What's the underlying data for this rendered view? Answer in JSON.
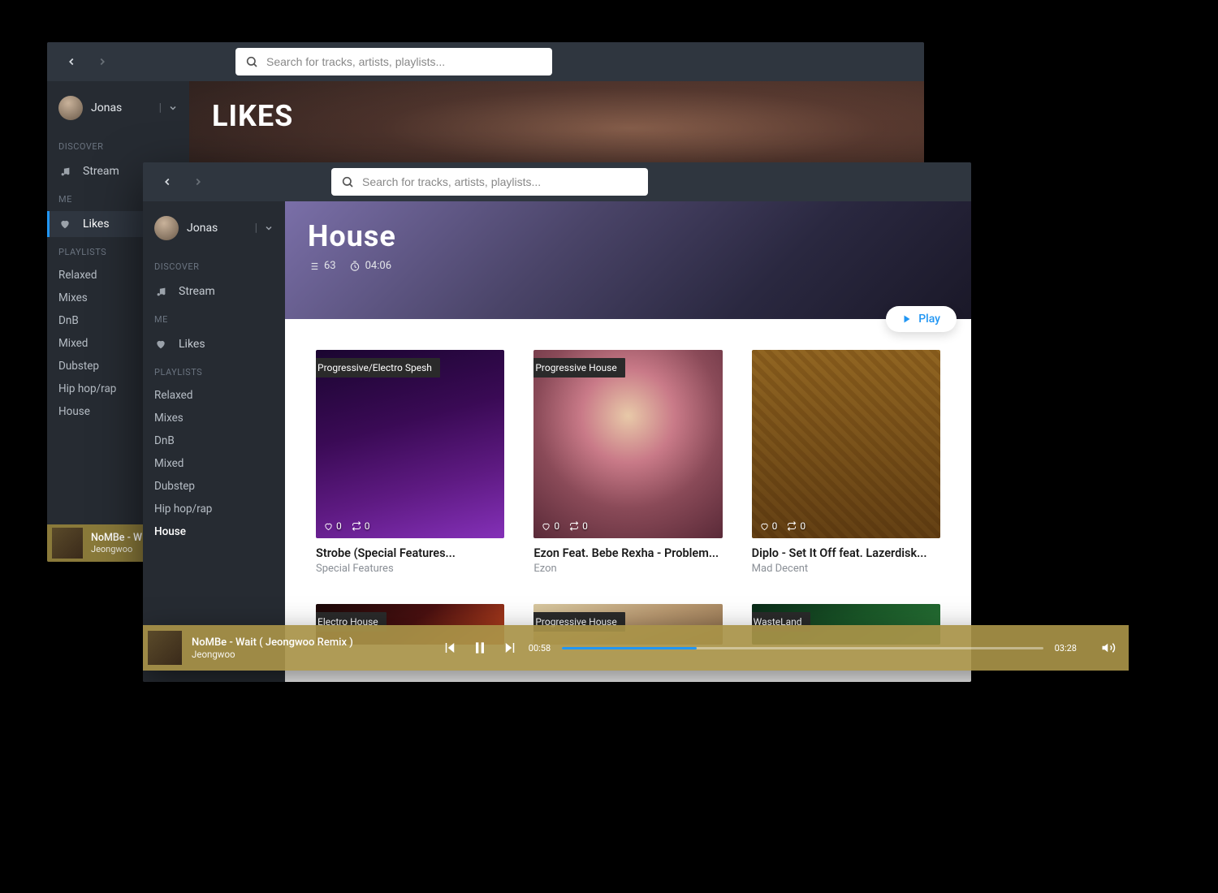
{
  "search": {
    "placeholder": "Search for tracks, artists, playlists..."
  },
  "user": {
    "name": "Jonas"
  },
  "sidebar": {
    "discover_label": "DISCOVER",
    "stream_label": "Stream",
    "me_label": "ME",
    "likes_label": "Likes",
    "playlists_label": "PLAYLISTS",
    "playlists": [
      {
        "label": "Relaxed"
      },
      {
        "label": "Mixes"
      },
      {
        "label": "DnB"
      },
      {
        "label": "Mixed"
      },
      {
        "label": "Dubstep"
      },
      {
        "label": "Hip hop/rap"
      },
      {
        "label": "House"
      }
    ]
  },
  "back_window": {
    "hero_title": "LIKES",
    "mini": {
      "title": "NoMBe - W",
      "artist": "Jeongwoo"
    }
  },
  "front_window": {
    "hero_title": "House",
    "track_count": "63",
    "duration": "04:06",
    "play_label": "Play"
  },
  "tracks": [
    {
      "tag": "Progressive/Electro Spesh",
      "title": "Strobe (Special Features...",
      "artist": "Special Features",
      "likes": "0",
      "reposts": "0"
    },
    {
      "tag": "Progressive House",
      "title": "Ezon Feat. Bebe Rexha - Problem...",
      "artist": "Ezon",
      "likes": "0",
      "reposts": "0"
    },
    {
      "tag": "",
      "title": "Diplo - Set It Off feat. Lazerdisk...",
      "artist": "Mad Decent",
      "likes": "0",
      "reposts": "0"
    },
    {
      "tag": "Electro House",
      "title": "",
      "artist": "",
      "likes": "",
      "reposts": ""
    },
    {
      "tag": "Progressive House",
      "title": "",
      "artist": "",
      "likes": "",
      "reposts": ""
    },
    {
      "tag": "WasteLand",
      "title": "",
      "artist": "",
      "likes": "",
      "reposts": ""
    }
  ],
  "player": {
    "title": "NoMBe - Wait ( Jeongwoo Remix )",
    "artist": "Jeongwoo",
    "elapsed": "00:58",
    "total": "03:28",
    "progress_pct": 28
  }
}
